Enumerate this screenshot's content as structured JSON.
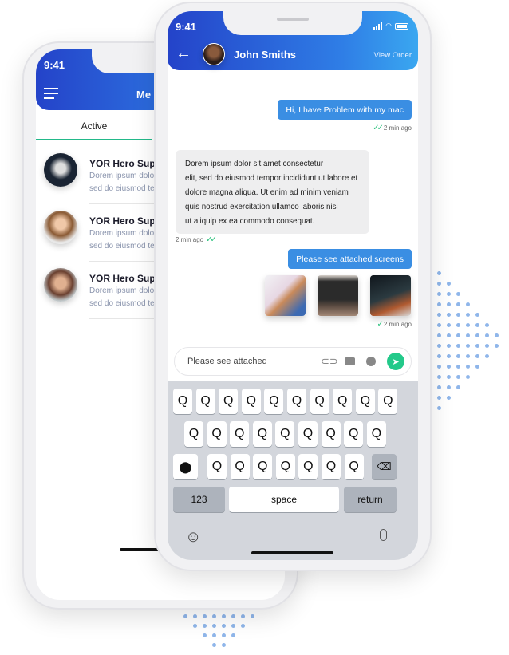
{
  "back_phone": {
    "time": "9:41",
    "title": "Me",
    "tab_active": "Active",
    "conversations": [
      {
        "name": "YOR Hero Supp",
        "preview1": "Dorem ipsum dolor",
        "preview2": "sed do eiusmod ten"
      },
      {
        "name": "YOR Hero Supp",
        "preview1": "Dorem ipsum dolor",
        "preview2": "sed do eiusmod ten"
      },
      {
        "name": "YOR Hero Supp",
        "preview1": "Dorem ipsum dolor",
        "preview2": "sed do eiusmod ten"
      }
    ]
  },
  "front_phone": {
    "time": "9:41",
    "contact_name": "John Smiths",
    "view_order": "View Order",
    "messages": [
      {
        "direction": "out",
        "text": "Hi, I have Problem with my mac",
        "time": "2 min ago"
      },
      {
        "direction": "in",
        "lines": [
          "Dorem ipsum dolor sit amet consectetur",
          "elit, sed do eiusmod tempor incididunt ut labore et",
          "dolore magna aliqua. Ut enim ad minim veniam",
          "quis nostrud exercitation ullamco laboris nisi",
          "ut aliquip ex ea commodo consequat."
        ],
        "time": "2 min ago"
      },
      {
        "direction": "out",
        "text": "Please see attached screens",
        "time": "2 min ago"
      }
    ],
    "input_value": "Please see attached",
    "keyboard": {
      "key": "Q",
      "numbers": "123",
      "space": "space",
      "return": "return"
    }
  },
  "colors": {
    "accent": "#2f7ee6",
    "send": "#23c98a",
    "bubble_out": "#3a8ee3",
    "tab_underline": "#23b98a"
  }
}
